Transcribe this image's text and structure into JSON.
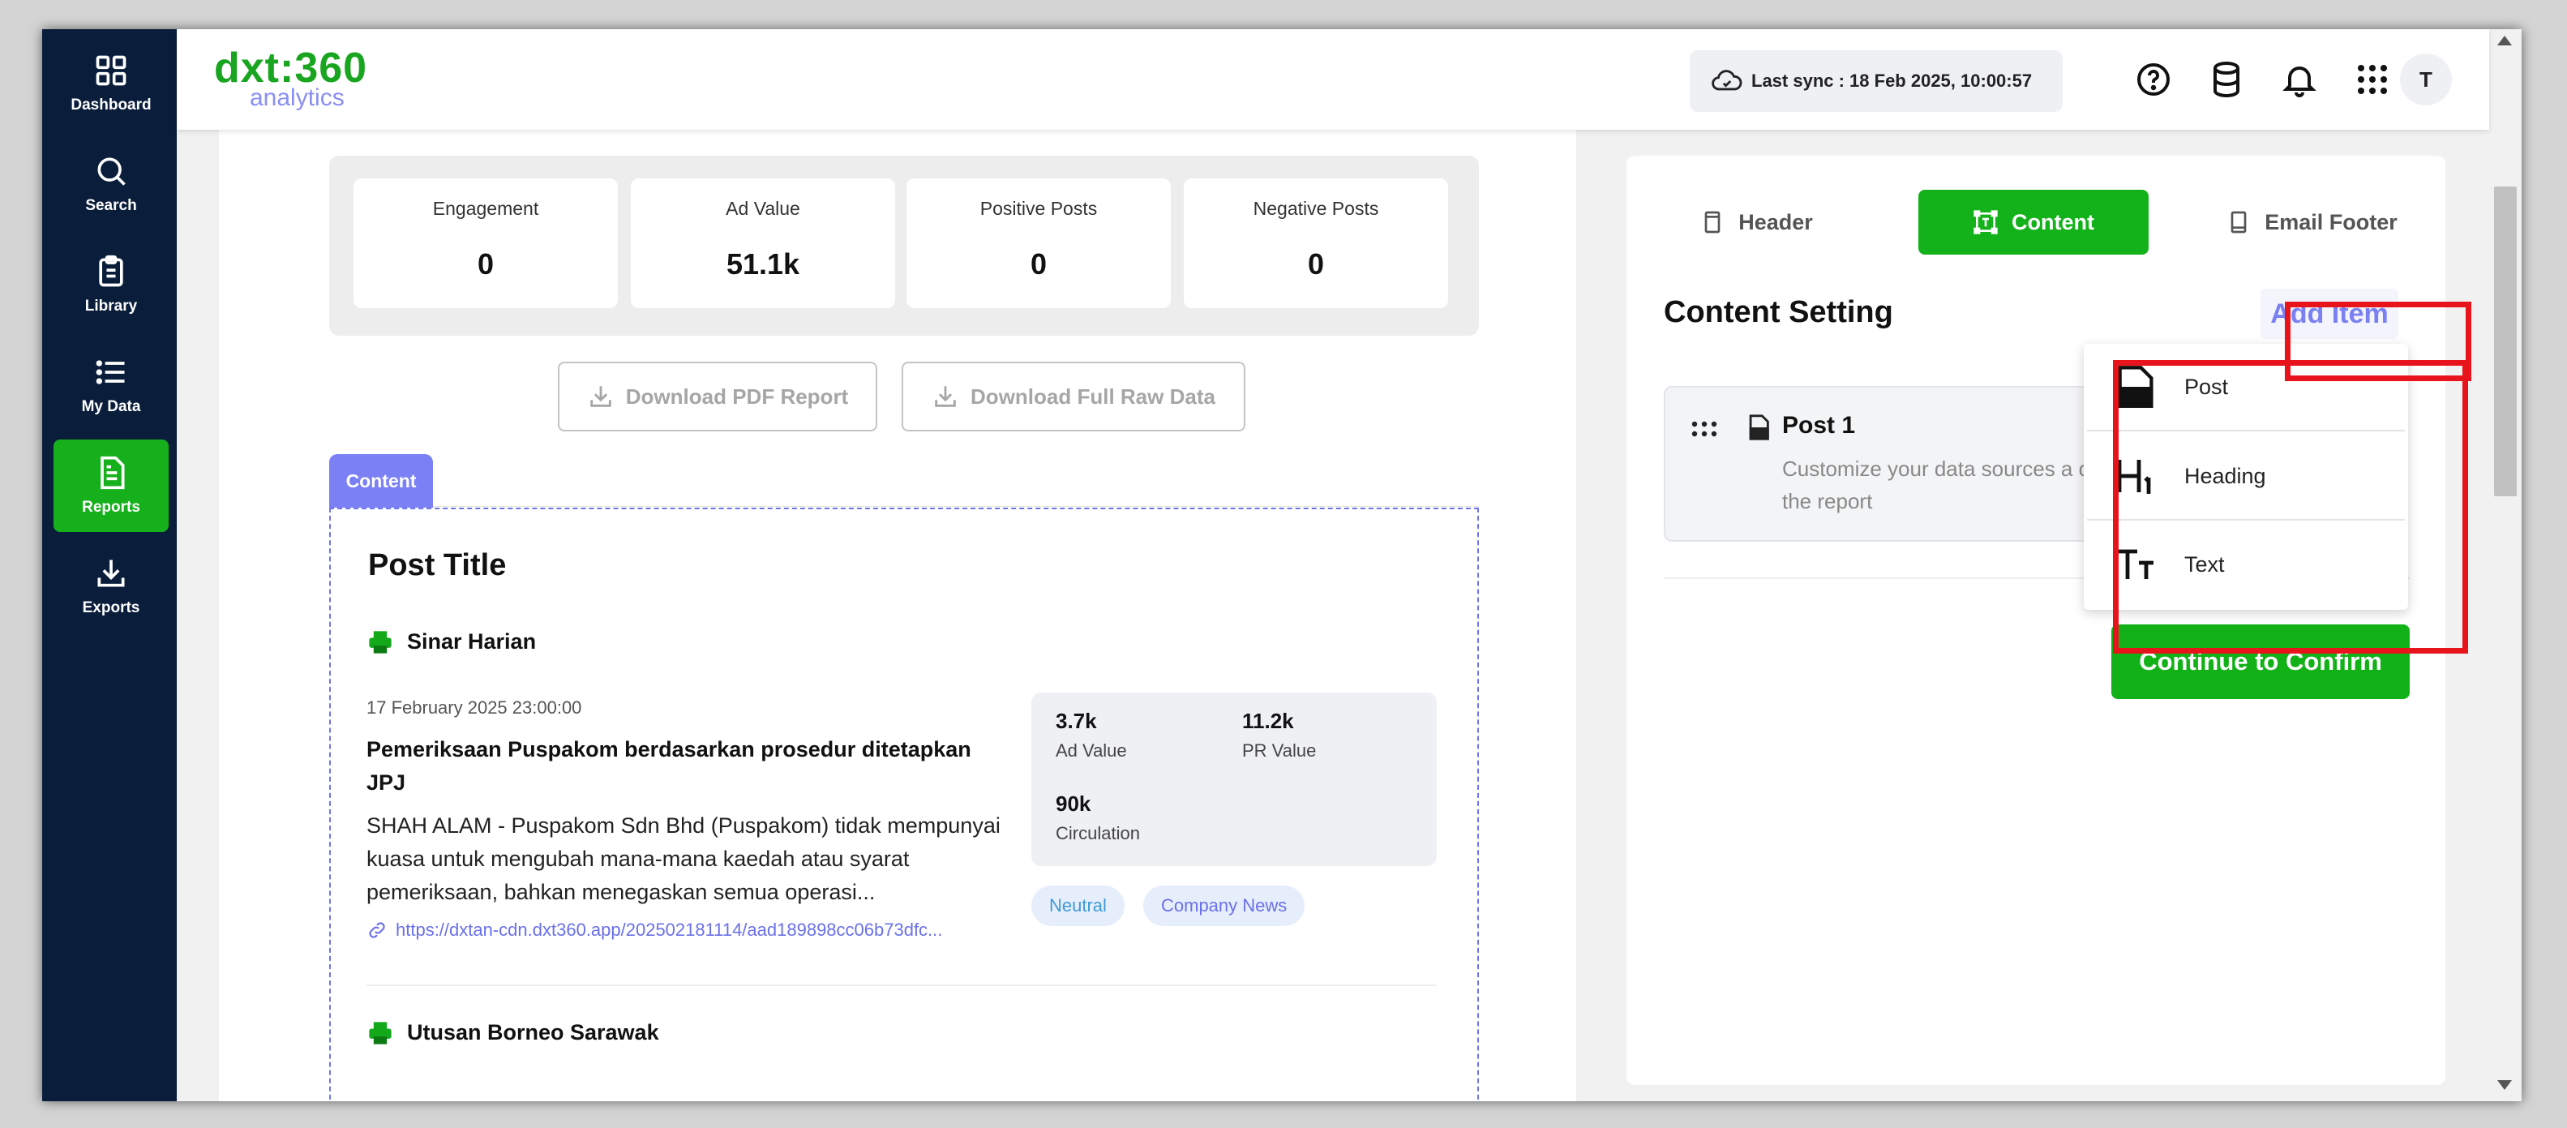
{
  "sidebar": {
    "items": [
      {
        "label": "Dashboard",
        "icon": "dashboard-icon"
      },
      {
        "label": "Search",
        "icon": "search-icon"
      },
      {
        "label": "Library",
        "icon": "clipboard-icon"
      },
      {
        "label": "My Data",
        "icon": "list-icon"
      },
      {
        "label": "Reports",
        "icon": "report-icon",
        "active": true
      },
      {
        "label": "Exports",
        "icon": "download-icon"
      }
    ]
  },
  "header": {
    "logo_main": "dxt:360",
    "logo_sub": "analytics",
    "sync_text": "Last sync : 18 Feb 2025, 10:00:57",
    "avatar_initial": "T",
    "icons": [
      "help-icon",
      "database-icon",
      "bell-icon",
      "apps-grid-icon"
    ]
  },
  "stats": [
    {
      "label": "Engagement",
      "value": "0"
    },
    {
      "label": "Ad Value",
      "value": "51.1k"
    },
    {
      "label": "Positive Posts",
      "value": "0"
    },
    {
      "label": "Negative Posts",
      "value": "0"
    }
  ],
  "downloads": {
    "pdf_label": "Download PDF Report",
    "raw_label": "Download Full Raw Data"
  },
  "content_tab": "Content",
  "post": {
    "title": "Post Title",
    "items": [
      {
        "publication": "Sinar Harian",
        "date": "17 February 2025 23:00:00",
        "headline": "Pemeriksaan Puspakom berdasarkan prosedur ditetapkan JPJ",
        "body": "SHAH ALAM - Puspakom Sdn Bhd (Puspakom) tidak mempunyai kuasa untuk mengubah mana-mana kaedah atau syarat pemeriksaan, bahkan menegaskan semua operasi...",
        "link": "https://dxtan-cdn.dxt360.app/202502181114/aad189898cc06b73dfc...",
        "metrics": [
          {
            "value": "3.7k",
            "label": "Ad Value"
          },
          {
            "value": "11.2k",
            "label": "PR Value"
          },
          {
            "value": "90k",
            "label": "Circulation"
          }
        ],
        "tags": [
          {
            "label": "Neutral",
            "color": "#3f9ad6"
          },
          {
            "label": "Company News",
            "color": "#6a70ea"
          }
        ]
      },
      {
        "publication": "Utusan Borneo Sarawak"
      }
    ]
  },
  "right": {
    "tabs": [
      {
        "label": "Header",
        "icon": "page-icon"
      },
      {
        "label": "Content",
        "icon": "text-frame-icon",
        "active": true
      },
      {
        "label": "Email Footer",
        "icon": "mobile-icon"
      }
    ],
    "content_setting_title": "Content Setting",
    "add_item_label": "Add Item",
    "post1_title": "Post 1",
    "post1_desc": "Customize your data sources a of the report",
    "continue_label": "Continue to Confirm"
  },
  "add_menu": {
    "items": [
      {
        "label": "Post",
        "icon": "post-doc-icon"
      },
      {
        "label": "Heading",
        "icon": "heading-h1-icon"
      },
      {
        "label": "Text",
        "icon": "text-tt-icon"
      }
    ]
  },
  "colors": {
    "brand_green": "#13b21a",
    "accent_purple": "#7b80f5",
    "sidebar_bg": "#0a1e3b",
    "highlight_red": "#e8141c"
  }
}
